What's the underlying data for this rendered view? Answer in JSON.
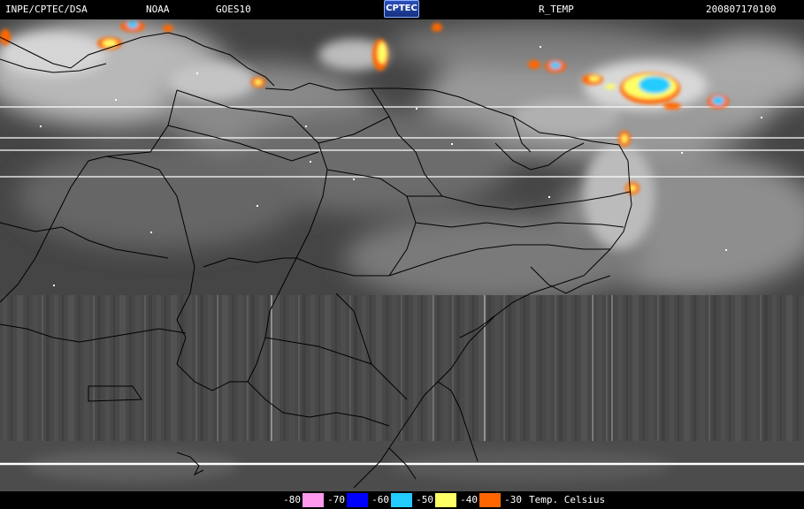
{
  "header": {
    "institution": "INPE/CPTEC/DSA",
    "agency": "NOAA",
    "satellite": "GOES10",
    "logo": "CPTEC",
    "product": "R_TEMP",
    "timestamp": "200807170100"
  },
  "legend": {
    "title": "Temp. Celsius",
    "items": [
      {
        "label": "-80",
        "color": "#ff99ee"
      },
      {
        "label": "-70",
        "color": "#0000ff"
      },
      {
        "label": "-60",
        "color": "#22ccff"
      },
      {
        "label": "-50",
        "color": "#ffff66"
      },
      {
        "label": "-40",
        "color": "#ff6600"
      },
      {
        "label": "-30",
        "color": ""
      }
    ]
  },
  "colors": {
    "background": "#000000",
    "land_base": "#4a4a4a",
    "cloud": "#d0d0d0",
    "border_lines": "#000000"
  }
}
